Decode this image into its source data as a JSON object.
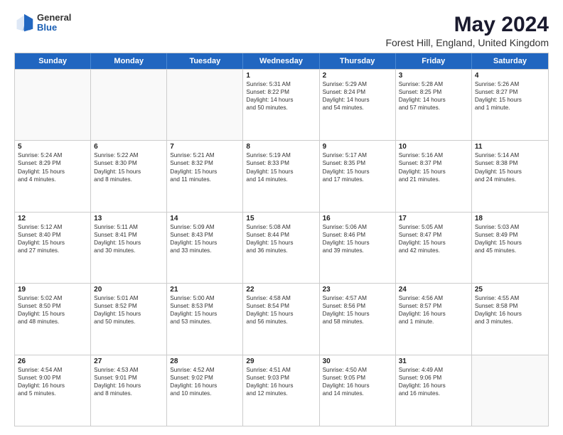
{
  "logo": {
    "general": "General",
    "blue": "Blue"
  },
  "title": "May 2024",
  "subtitle": "Forest Hill, England, United Kingdom",
  "header_days": [
    "Sunday",
    "Monday",
    "Tuesday",
    "Wednesday",
    "Thursday",
    "Friday",
    "Saturday"
  ],
  "rows": [
    [
      {
        "day": "",
        "empty": true
      },
      {
        "day": "",
        "empty": true
      },
      {
        "day": "",
        "empty": true
      },
      {
        "day": "1",
        "lines": [
          "Sunrise: 5:31 AM",
          "Sunset: 8:22 PM",
          "Daylight: 14 hours",
          "and 50 minutes."
        ]
      },
      {
        "day": "2",
        "lines": [
          "Sunrise: 5:29 AM",
          "Sunset: 8:24 PM",
          "Daylight: 14 hours",
          "and 54 minutes."
        ]
      },
      {
        "day": "3",
        "lines": [
          "Sunrise: 5:28 AM",
          "Sunset: 8:25 PM",
          "Daylight: 14 hours",
          "and 57 minutes."
        ]
      },
      {
        "day": "4",
        "lines": [
          "Sunrise: 5:26 AM",
          "Sunset: 8:27 PM",
          "Daylight: 15 hours",
          "and 1 minute."
        ]
      }
    ],
    [
      {
        "day": "5",
        "lines": [
          "Sunrise: 5:24 AM",
          "Sunset: 8:29 PM",
          "Daylight: 15 hours",
          "and 4 minutes."
        ]
      },
      {
        "day": "6",
        "lines": [
          "Sunrise: 5:22 AM",
          "Sunset: 8:30 PM",
          "Daylight: 15 hours",
          "and 8 minutes."
        ]
      },
      {
        "day": "7",
        "lines": [
          "Sunrise: 5:21 AM",
          "Sunset: 8:32 PM",
          "Daylight: 15 hours",
          "and 11 minutes."
        ]
      },
      {
        "day": "8",
        "lines": [
          "Sunrise: 5:19 AM",
          "Sunset: 8:33 PM",
          "Daylight: 15 hours",
          "and 14 minutes."
        ]
      },
      {
        "day": "9",
        "lines": [
          "Sunrise: 5:17 AM",
          "Sunset: 8:35 PM",
          "Daylight: 15 hours",
          "and 17 minutes."
        ]
      },
      {
        "day": "10",
        "lines": [
          "Sunrise: 5:16 AM",
          "Sunset: 8:37 PM",
          "Daylight: 15 hours",
          "and 21 minutes."
        ]
      },
      {
        "day": "11",
        "lines": [
          "Sunrise: 5:14 AM",
          "Sunset: 8:38 PM",
          "Daylight: 15 hours",
          "and 24 minutes."
        ]
      }
    ],
    [
      {
        "day": "12",
        "lines": [
          "Sunrise: 5:12 AM",
          "Sunset: 8:40 PM",
          "Daylight: 15 hours",
          "and 27 minutes."
        ]
      },
      {
        "day": "13",
        "lines": [
          "Sunrise: 5:11 AM",
          "Sunset: 8:41 PM",
          "Daylight: 15 hours",
          "and 30 minutes."
        ]
      },
      {
        "day": "14",
        "lines": [
          "Sunrise: 5:09 AM",
          "Sunset: 8:43 PM",
          "Daylight: 15 hours",
          "and 33 minutes."
        ]
      },
      {
        "day": "15",
        "lines": [
          "Sunrise: 5:08 AM",
          "Sunset: 8:44 PM",
          "Daylight: 15 hours",
          "and 36 minutes."
        ]
      },
      {
        "day": "16",
        "lines": [
          "Sunrise: 5:06 AM",
          "Sunset: 8:46 PM",
          "Daylight: 15 hours",
          "and 39 minutes."
        ]
      },
      {
        "day": "17",
        "lines": [
          "Sunrise: 5:05 AM",
          "Sunset: 8:47 PM",
          "Daylight: 15 hours",
          "and 42 minutes."
        ]
      },
      {
        "day": "18",
        "lines": [
          "Sunrise: 5:03 AM",
          "Sunset: 8:49 PM",
          "Daylight: 15 hours",
          "and 45 minutes."
        ]
      }
    ],
    [
      {
        "day": "19",
        "lines": [
          "Sunrise: 5:02 AM",
          "Sunset: 8:50 PM",
          "Daylight: 15 hours",
          "and 48 minutes."
        ]
      },
      {
        "day": "20",
        "lines": [
          "Sunrise: 5:01 AM",
          "Sunset: 8:52 PM",
          "Daylight: 15 hours",
          "and 50 minutes."
        ]
      },
      {
        "day": "21",
        "lines": [
          "Sunrise: 5:00 AM",
          "Sunset: 8:53 PM",
          "Daylight: 15 hours",
          "and 53 minutes."
        ]
      },
      {
        "day": "22",
        "lines": [
          "Sunrise: 4:58 AM",
          "Sunset: 8:54 PM",
          "Daylight: 15 hours",
          "and 56 minutes."
        ]
      },
      {
        "day": "23",
        "lines": [
          "Sunrise: 4:57 AM",
          "Sunset: 8:56 PM",
          "Daylight: 15 hours",
          "and 58 minutes."
        ]
      },
      {
        "day": "24",
        "lines": [
          "Sunrise: 4:56 AM",
          "Sunset: 8:57 PM",
          "Daylight: 16 hours",
          "and 1 minute."
        ]
      },
      {
        "day": "25",
        "lines": [
          "Sunrise: 4:55 AM",
          "Sunset: 8:58 PM",
          "Daylight: 16 hours",
          "and 3 minutes."
        ]
      }
    ],
    [
      {
        "day": "26",
        "lines": [
          "Sunrise: 4:54 AM",
          "Sunset: 9:00 PM",
          "Daylight: 16 hours",
          "and 5 minutes."
        ]
      },
      {
        "day": "27",
        "lines": [
          "Sunrise: 4:53 AM",
          "Sunset: 9:01 PM",
          "Daylight: 16 hours",
          "and 8 minutes."
        ]
      },
      {
        "day": "28",
        "lines": [
          "Sunrise: 4:52 AM",
          "Sunset: 9:02 PM",
          "Daylight: 16 hours",
          "and 10 minutes."
        ]
      },
      {
        "day": "29",
        "lines": [
          "Sunrise: 4:51 AM",
          "Sunset: 9:03 PM",
          "Daylight: 16 hours",
          "and 12 minutes."
        ]
      },
      {
        "day": "30",
        "lines": [
          "Sunrise: 4:50 AM",
          "Sunset: 9:05 PM",
          "Daylight: 16 hours",
          "and 14 minutes."
        ]
      },
      {
        "day": "31",
        "lines": [
          "Sunrise: 4:49 AM",
          "Sunset: 9:06 PM",
          "Daylight: 16 hours",
          "and 16 minutes."
        ]
      },
      {
        "day": "",
        "empty": true
      }
    ]
  ]
}
